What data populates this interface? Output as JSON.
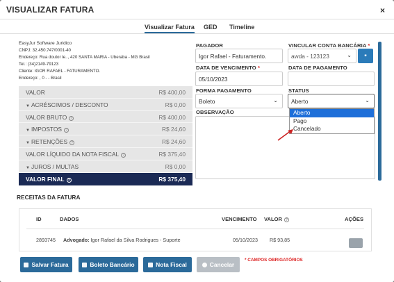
{
  "header": {
    "title": "VISUALIZAR FATURA",
    "close": "×"
  },
  "tabs": [
    "Visualizar Fatura",
    "GED",
    "Timeline"
  ],
  "company": {
    "name": "EasyJur Software Juridico",
    "lines": [
      "CNPJ: 32.450.747/0001-40",
      "Endereço: Rua doutor le.., 420 SANTA MARIA - Uberaba - MG Brasil",
      "Tel.: (34)2149-79123",
      "Cliente: IGOR RAFAEL - FATURAMENTO.",
      "Endereço: , 0 - - Brasil"
    ]
  },
  "summary": [
    {
      "label": "VALOR",
      "value": "R$ 400,00"
    },
    {
      "label": "ACRÉSCIMOS / DESCONTO",
      "value": "R$ 0,00"
    },
    {
      "label": "VALOR BRUTO",
      "value": "R$ 400,00"
    },
    {
      "label": "IMPOSTOS",
      "value": "R$ 24,60"
    },
    {
      "label": "RETENÇÕES",
      "value": "R$ 24,60"
    },
    {
      "label": "VALOR LÍQUIDO DA NOTA FISCAL",
      "value": "R$ 375,40"
    },
    {
      "label": "JUROS / MULTAS",
      "value": "R$ 0,00"
    },
    {
      "label": "VALOR FINAL",
      "value": "R$ 375,40"
    }
  ],
  "form": {
    "pagador_label": "PAGADOR",
    "pagador_value": "Igor Rafael - Faturamento.",
    "conta_label": "VINCULAR CONTA BANCÁRIA",
    "conta_value": "awda - 123123",
    "vencimento_label": "DATA DE VENCIMENTO",
    "vencimento_value": "05/10/2023",
    "pagamento_label": "DATA DE PAGAMENTO",
    "pagamento_value": "",
    "forma_label": "FORMA PAGAMENTO",
    "forma_value": "Boleto",
    "status_label": "STATUS",
    "status_value": "Aberto",
    "status_options": [
      "Aberto",
      "Pago",
      "Cancelado"
    ],
    "obs_label": "OBSERVAÇÃO",
    "required_mark": "*"
  },
  "receitas": {
    "title": "RECEITAS DA FATURA",
    "headers": [
      "ID",
      "DADOS",
      "VENCIMENTO",
      "VALOR",
      "AÇÕES"
    ],
    "row": {
      "id": "2893745",
      "dados_label": "Advogado:",
      "dados_value": "Igor Rafael da Silva Rodrigues - Suporte",
      "vencimento": "05/10/2023",
      "valor": "R$ 93,85"
    }
  },
  "footer": {
    "salvar": "Salvar Fatura",
    "boleto": "Boleto Bancário",
    "nota": "Nota Fiscal",
    "cancelar": "Cancelar",
    "required_note": "* CAMPOS OBRIGATÓRIOS"
  },
  "colors": {
    "primary": "#2b6a9a",
    "final_row": "#1b2a55",
    "required": "#dd2222",
    "selected_option": "#1e6fd9"
  }
}
